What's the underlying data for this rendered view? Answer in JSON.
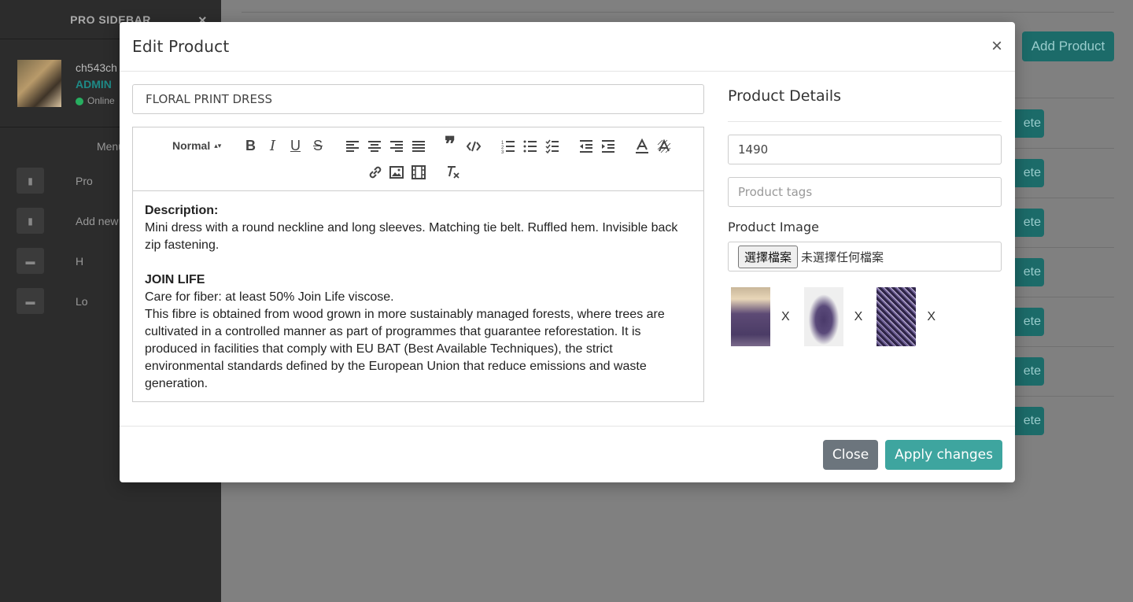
{
  "sidebar": {
    "title": "PRO SIDEBAR",
    "close": "×",
    "user": {
      "name": "ch543ch",
      "role": "ADMIN",
      "status": "Online"
    },
    "menu_title": "Menu",
    "items": [
      {
        "label": "Pro",
        "icon": "book-icon"
      },
      {
        "label": "Add new",
        "icon": "book-icon"
      },
      {
        "label": "H",
        "icon": "folder-icon"
      },
      {
        "label": "Lo",
        "icon": "folder-icon"
      }
    ]
  },
  "main": {
    "add_product_label": "Add Product",
    "delete_label": "ete"
  },
  "modal": {
    "title": "Edit Product",
    "close": "×",
    "product_title": "FLORAL PRINT DRESS",
    "toolbar": {
      "header_select": "Normal",
      "bold": "B",
      "italic": "I",
      "underline": "U",
      "strike": "S"
    },
    "content": {
      "desc_heading": "Description:",
      "desc_text": "Mini dress with a round neckline and long sleeves. Matching tie belt. Ruffled hem. Invisible back zip fastening.",
      "join_heading": "JOIN LIFE",
      "join_line1": "Care for fiber: at least 50% Join Life viscose.",
      "join_line2": "This fibre is obtained from wood grown in more sustainably managed forests, where trees are cultivated in a controlled manner as part of programmes that guarantee reforestation. It is produced in facilities that comply with EU BAT (Best Available Techniques), the strict environmental standards defined by the European Union that reduce emissions and waste generation."
    },
    "details_title": "Product Details",
    "price_value": "1490",
    "tags_placeholder": "Product tags",
    "image_label": "Product Image",
    "file_button": "選擇檔案",
    "file_status": "未選擇任何檔案",
    "remove_label": "X",
    "close_button": "Close",
    "apply_button": "Apply changes"
  }
}
